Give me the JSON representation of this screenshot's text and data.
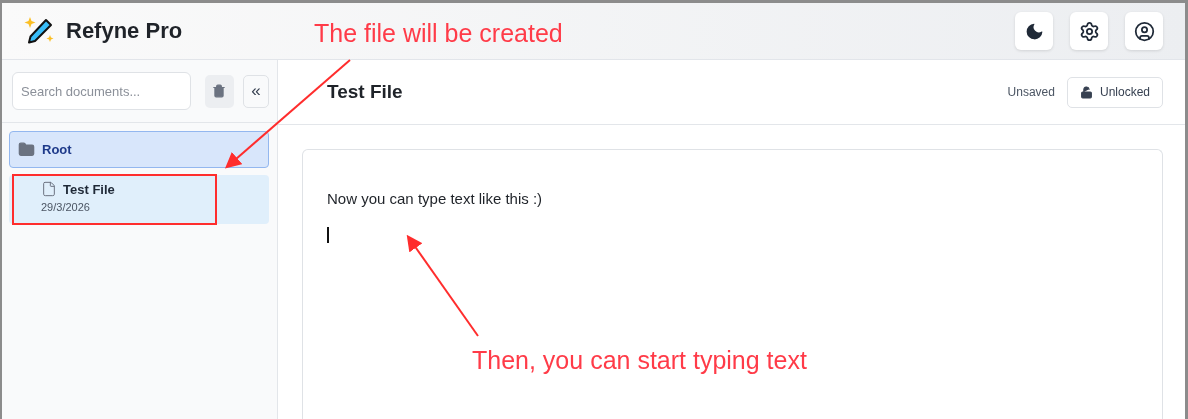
{
  "app": {
    "title": "Refyne Pro"
  },
  "header_buttons": [
    {
      "kind": "theme"
    },
    {
      "kind": "settings"
    },
    {
      "kind": "account"
    }
  ],
  "sidebar": {
    "search": {
      "placeholder": "Search documents..."
    },
    "collapse_button": "«",
    "tree": [
      {
        "kind": "folder",
        "name": "Root",
        "selected": true,
        "children": [
          {
            "kind": "file",
            "name": "Test File",
            "date": "29/3/2026",
            "selected": true
          }
        ]
      }
    ]
  },
  "document": {
    "title": "Test File",
    "status": "Unsaved",
    "lock": {
      "label": "Unlocked",
      "locked": false
    },
    "paragraphs": [
      "Now you can type text like this :)"
    ],
    "cursor": true
  },
  "annotations": [
    {
      "kind": "callout",
      "text": "The file will be created"
    },
    {
      "kind": "callout",
      "text": "Then, you can start typing text"
    }
  ]
}
